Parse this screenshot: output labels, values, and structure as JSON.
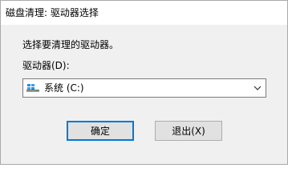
{
  "window": {
    "title": "磁盘清理: 驱动器选择"
  },
  "dialog": {
    "instruction": "选择要清理的驱动器。",
    "drive_label": "驱动器(D):",
    "drive_select": {
      "selected_value": "系统 (C:)",
      "icon": "drive-icon"
    }
  },
  "buttons": {
    "ok_label": "确定",
    "exit_label": "退出(X)"
  },
  "colors": {
    "accent": "#0078d7",
    "dialog_background": "#f0f0f0"
  }
}
